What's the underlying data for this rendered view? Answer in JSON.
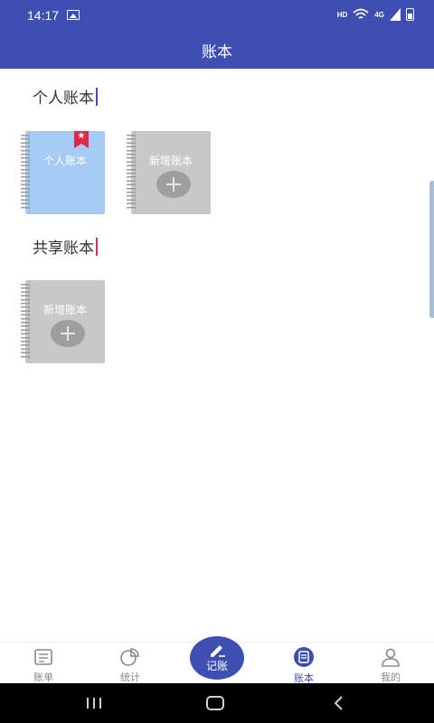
{
  "status_bar": {
    "time": "14:17",
    "image_icon": "image-icon",
    "hd_label": "HD",
    "network_label": "4G",
    "wifi_icon": "wifi-icon",
    "signal_icon": "signal-icon",
    "battery_icon": "battery-icon"
  },
  "header": {
    "title": "账本"
  },
  "personal": {
    "title": "个人账本",
    "caret_color": "#3e4fb2",
    "books": [
      {
        "label": "个人账本",
        "color": "#a6cbf4",
        "bookmark": "star-bookmark-icon"
      },
      {
        "label": "新增账本",
        "color": "#c8c8c8",
        "icon": "plus-icon"
      }
    ]
  },
  "shared": {
    "title": "共享账本",
    "caret_color": "#e0284a",
    "books": [
      {
        "label": "新增账本",
        "color": "#c8c8c8",
        "icon": "plus-icon"
      }
    ]
  },
  "bottom_nav": {
    "items": [
      {
        "label": "账单",
        "icon": "bill-icon",
        "active": false
      },
      {
        "label": "统计",
        "icon": "pie-chart-icon",
        "active": false
      },
      {
        "label": "记账",
        "icon": "pencil-icon",
        "center": true
      },
      {
        "label": "账本",
        "icon": "notebook-icon",
        "active": true
      },
      {
        "label": "我的",
        "icon": "person-icon",
        "active": false
      }
    ]
  },
  "colors": {
    "primary": "#3e4fb2",
    "accent_red": "#e0284a",
    "book_blue": "#a6cbf4",
    "book_grey": "#c8c8c8",
    "inactive_text": "#888888"
  },
  "system_nav": {
    "recents": "recents-icon",
    "home": "home-icon",
    "back": "back-icon"
  }
}
